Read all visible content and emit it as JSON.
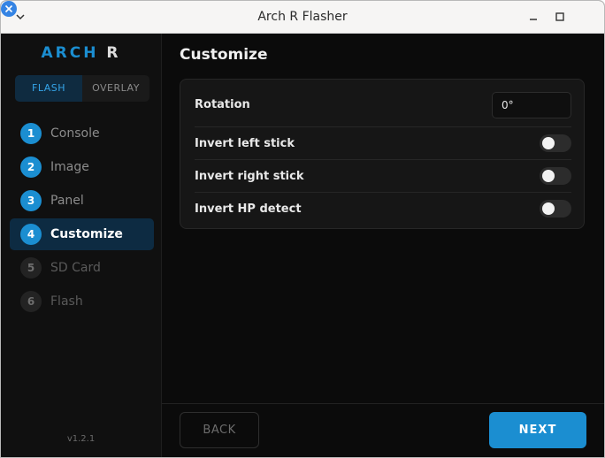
{
  "window": {
    "title": "Arch R Flasher",
    "icons": [
      "chevron-down-icon",
      "minimize-icon",
      "maximize-icon",
      "close-icon"
    ],
    "accent": "#3584e4"
  },
  "sidebar": {
    "brand": {
      "part1": "ARCH",
      "part2": "R"
    },
    "mode_tabs": [
      {
        "label": "FLASH",
        "selected": true
      },
      {
        "label": "OVERLAY",
        "selected": false
      }
    ],
    "steps": [
      {
        "number": "1",
        "label": "Console",
        "state": "done"
      },
      {
        "number": "2",
        "label": "Image",
        "state": "done"
      },
      {
        "number": "3",
        "label": "Panel",
        "state": "done"
      },
      {
        "number": "4",
        "label": "Customize",
        "state": "active"
      },
      {
        "number": "5",
        "label": "SD Card",
        "state": "future"
      },
      {
        "number": "6",
        "label": "Flash",
        "state": "future"
      }
    ],
    "version": "v1.2.1"
  },
  "main": {
    "title": "Customize",
    "settings": {
      "rotation": {
        "label": "Rotation",
        "value": "0°"
      },
      "invert_left_stick": {
        "label": "Invert left stick",
        "on": false
      },
      "invert_right_stick": {
        "label": "Invert right stick",
        "on": false
      },
      "invert_hp_detect": {
        "label": "Invert HP detect",
        "on": false
      }
    }
  },
  "footer": {
    "back_label": "BACK",
    "next_label": "NEXT"
  },
  "colors": {
    "primary": "#1b8ed1",
    "background": "#0b0b0b",
    "card": "#161616"
  }
}
